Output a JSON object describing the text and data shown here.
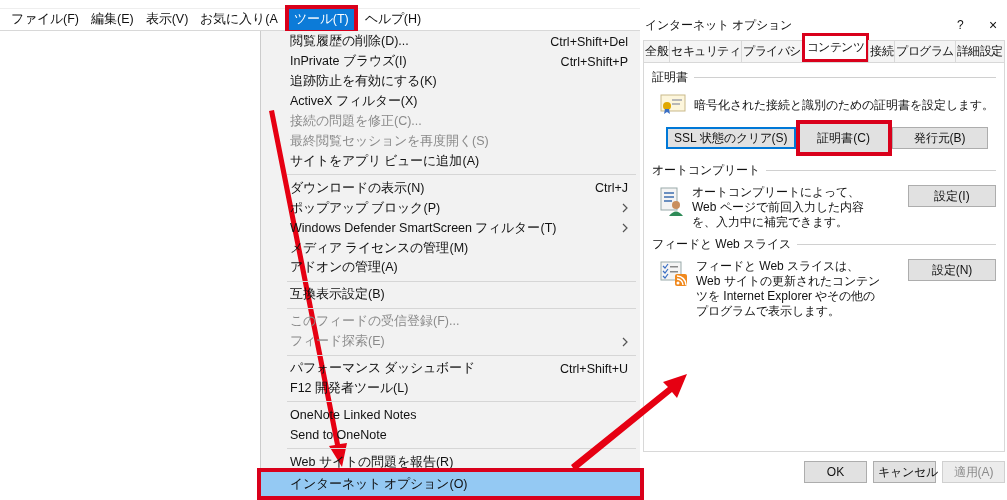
{
  "menu_bar": {
    "items": [
      {
        "label": "ファイル(F)",
        "selected": false,
        "highlighted": false
      },
      {
        "label": "編集(E)",
        "selected": false,
        "highlighted": false
      },
      {
        "label": "表示(V)",
        "selected": false,
        "highlighted": false
      },
      {
        "label": "お気に入り(A",
        "selected": false,
        "highlighted": false
      },
      {
        "label": "ツール(T)",
        "selected": true,
        "highlighted": true
      },
      {
        "label": "ヘルプ(H)",
        "selected": false,
        "highlighted": false
      }
    ]
  },
  "tools_menu": {
    "sections": [
      [
        {
          "label": "閲覧履歴の削除(D)...",
          "shortcut": "Ctrl+Shift+Del",
          "disabled": false,
          "submenu": false,
          "selected": false,
          "highlighted": false
        },
        {
          "label": "InPrivate ブラウズ(I)",
          "shortcut": "Ctrl+Shift+P",
          "disabled": false,
          "submenu": false,
          "selected": false,
          "highlighted": false
        },
        {
          "label": "追跡防止を有効にする(K)",
          "disabled": false,
          "submenu": false,
          "selected": false,
          "highlighted": false
        },
        {
          "label": "ActiveX フィルター(X)",
          "disabled": false,
          "submenu": false,
          "selected": false,
          "highlighted": false
        },
        {
          "label": "接続の問題を修正(C)...",
          "disabled": true,
          "submenu": false,
          "selected": false,
          "highlighted": false
        },
        {
          "label": "最終閲覧セッションを再度開く(S)",
          "disabled": true,
          "submenu": false,
          "selected": false,
          "highlighted": false
        },
        {
          "label": "サイトをアプリ ビューに追加(A)",
          "disabled": false,
          "submenu": false,
          "selected": false,
          "highlighted": false
        }
      ],
      [
        {
          "label": "ダウンロードの表示(N)",
          "shortcut": "Ctrl+J",
          "disabled": false,
          "submenu": false,
          "selected": false,
          "highlighted": false
        },
        {
          "label": "ポップアップ ブロック(P)",
          "disabled": false,
          "submenu": true,
          "selected": false,
          "highlighted": false
        },
        {
          "label": "Windows Defender SmartScreen フィルター(T)",
          "disabled": false,
          "submenu": true,
          "selected": false,
          "highlighted": false
        },
        {
          "label": "メディア ライセンスの管理(M)",
          "disabled": false,
          "submenu": false,
          "selected": false,
          "highlighted": false
        },
        {
          "label": "アドオンの管理(A)",
          "disabled": false,
          "submenu": false,
          "selected": false,
          "highlighted": false
        }
      ],
      [
        {
          "label": "互換表示設定(B)",
          "disabled": false,
          "submenu": false,
          "selected": false,
          "highlighted": false
        }
      ],
      [
        {
          "label": "このフィードの受信登録(F)...",
          "disabled": true,
          "submenu": false,
          "selected": false,
          "highlighted": false
        },
        {
          "label": "フィード探索(E)",
          "disabled": true,
          "submenu": true,
          "selected": false,
          "highlighted": false
        }
      ],
      [
        {
          "label": "パフォーマンス ダッシュボード",
          "shortcut": "Ctrl+Shift+U",
          "disabled": false,
          "submenu": false,
          "selected": false,
          "highlighted": false
        },
        {
          "label": "F12 開発者ツール(L)",
          "disabled": false,
          "submenu": false,
          "selected": false,
          "highlighted": false
        }
      ],
      [
        {
          "label": "OneNote Linked Notes",
          "disabled": false,
          "submenu": false,
          "selected": false,
          "highlighted": false
        },
        {
          "label": "Send to OneNote",
          "disabled": false,
          "submenu": false,
          "selected": false,
          "highlighted": false
        }
      ],
      [
        {
          "label": "Web サイトの問題を報告(R)",
          "disabled": false,
          "submenu": false,
          "selected": false,
          "highlighted": false
        },
        {
          "label": "インターネット オプション(O)",
          "disabled": false,
          "submenu": false,
          "selected": true,
          "highlighted": true
        }
      ]
    ]
  },
  "dialog": {
    "title": "インターネット オプション",
    "help": "?",
    "close": "×",
    "tabs": [
      {
        "label": "全般",
        "selected": false,
        "highlighted": false
      },
      {
        "label": "セキュリティ",
        "selected": false,
        "highlighted": false
      },
      {
        "label": "プライバシ",
        "selected": false,
        "highlighted": false
      },
      {
        "label": "コンテンツ",
        "selected": true,
        "highlighted": true
      },
      {
        "label": "接続",
        "selected": false,
        "highlighted": false
      },
      {
        "label": "プログラム",
        "selected": false,
        "highlighted": false
      },
      {
        "label": "詳細設定",
        "selected": false,
        "highlighted": false
      }
    ],
    "groups": [
      {
        "kind": "certificate",
        "title": "証明書",
        "text": "暗号化された接続と識別のための証明書を設定します。",
        "buttons": [
          {
            "label": "SSL 状態のクリア(S)",
            "focused": true,
            "highlighted": false
          },
          {
            "label": "証明書(C)",
            "focused": false,
            "highlighted": true
          },
          {
            "label": "発行元(B)",
            "focused": false,
            "highlighted": false
          }
        ]
      },
      {
        "kind": "autocomplete",
        "title": "オートコンプリート",
        "text": "オートコンプリートによって、Web ページで前回入力した内容を、入力中に補完できます。",
        "buttons": [
          {
            "label": "設定(I)",
            "focused": false,
            "highlighted": false
          }
        ]
      },
      {
        "kind": "feeds",
        "title": "フィードと Web スライス",
        "text": "フィードと Web スライスは、Web サイトの更新されたコンテンツを Internet Explorer やその他のプログラムで表示します。",
        "buttons": [
          {
            "label": "設定(N)",
            "focused": false,
            "highlighted": false
          }
        ]
      }
    ],
    "footer_buttons": [
      {
        "label": "OK",
        "disabled": false
      },
      {
        "label": "キャンセル",
        "disabled": false
      },
      {
        "label": "適用(A)",
        "disabled": true
      }
    ]
  }
}
